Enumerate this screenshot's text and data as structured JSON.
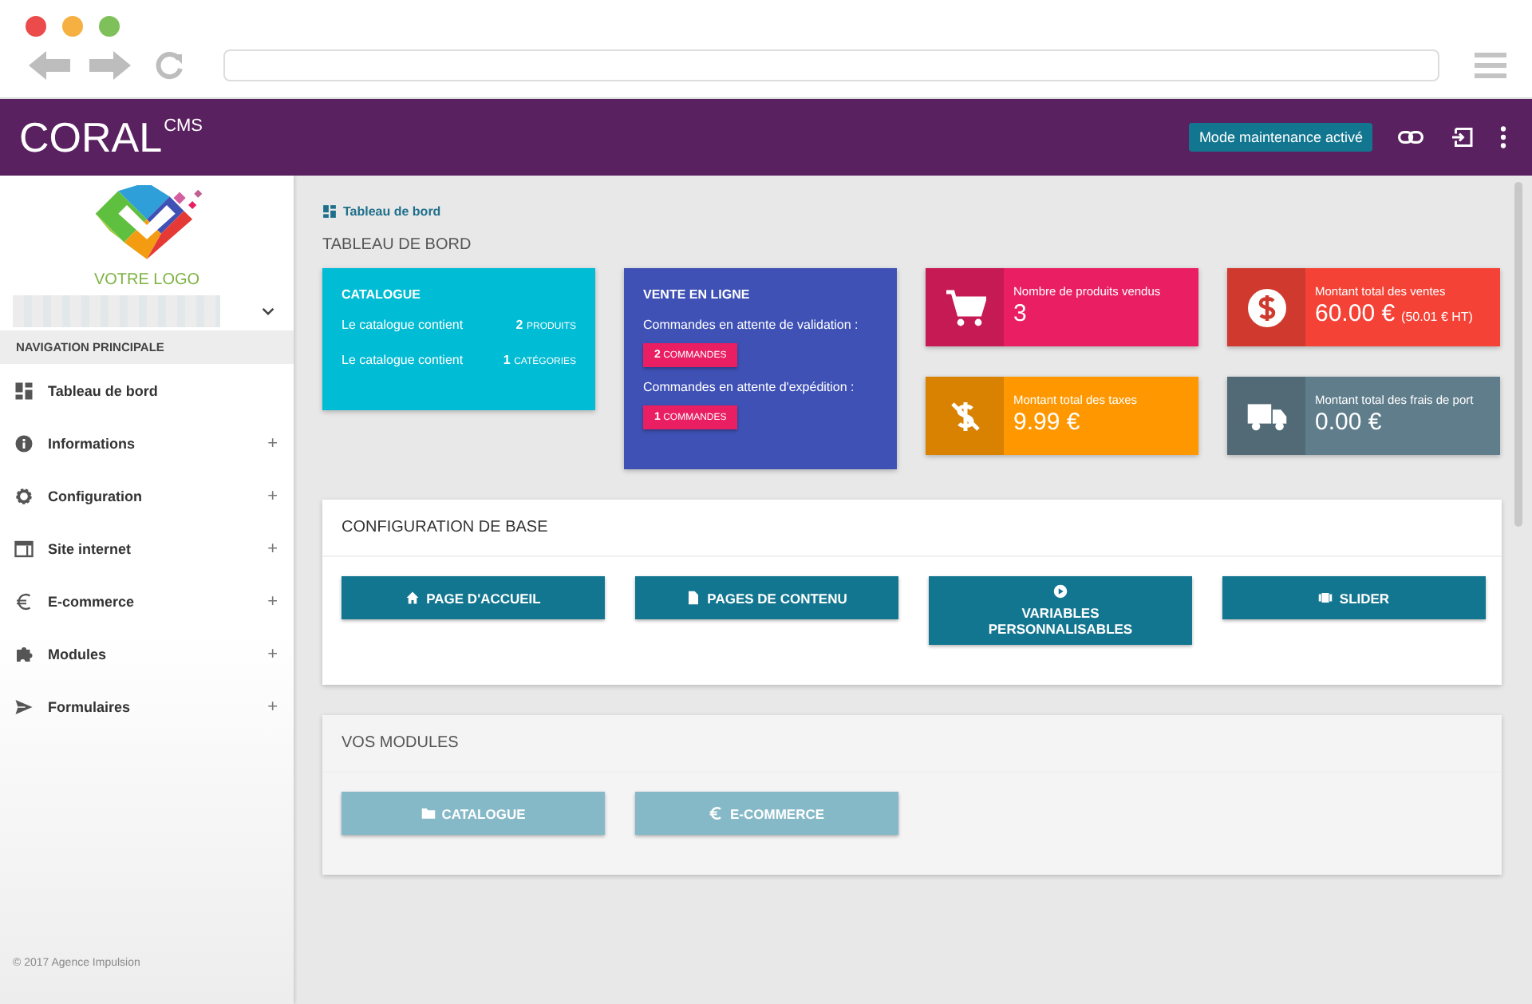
{
  "header": {
    "logo": "CORAL",
    "logo_suffix": "CMS",
    "maintenance_button": "Mode maintenance activé"
  },
  "sidebar": {
    "logo_caption": "VOTRE LOGO",
    "nav_heading": "NAVIGATION PRINCIPALE",
    "items": [
      {
        "kind": "dashboard",
        "label": "Tableau de bord"
      },
      {
        "kind": "info",
        "label": "Informations",
        "expander": "+"
      },
      {
        "kind": "gear",
        "label": "Configuration",
        "expander": "+"
      },
      {
        "kind": "window",
        "label": "Site internet",
        "expander": "+"
      },
      {
        "kind": "euro",
        "label": "E-commerce",
        "expander": "+"
      },
      {
        "kind": "puzzle",
        "label": "Modules",
        "expander": "+"
      },
      {
        "kind": "send",
        "label": "Formulaires",
        "expander": "+"
      }
    ],
    "footer": "© 2017 Agence Impulsion"
  },
  "breadcrumb": "Tableau de bord",
  "page_title": "TABLEAU DE BORD",
  "catalogue_card": {
    "title": "CATALOGUE",
    "rows": [
      {
        "label": "Le catalogue contient",
        "count": "2",
        "unit": "PRODUITS"
      },
      {
        "label": "Le catalogue contient",
        "count": "1",
        "unit": "CATÉGORIES"
      }
    ]
  },
  "sales_card": {
    "title": "VENTE EN LIGNE",
    "rows": [
      {
        "label": "Commandes en attente de validation :",
        "count": "2",
        "unit": "COMMANDES"
      },
      {
        "label": "Commandes en attente d'expédition :",
        "count": "1",
        "unit": "COMMANDES"
      }
    ]
  },
  "stats": [
    {
      "kind": "cart",
      "label": "Nombre de produits vendus",
      "value": "3",
      "color": "#e91e63"
    },
    {
      "kind": "dollar",
      "label": "Montant total des ventes",
      "value": "60.00 €",
      "extra": "(50.01 € HT)",
      "color": "#f44336"
    },
    {
      "kind": "tax",
      "label": "Montant total des taxes",
      "value": "9.99 €",
      "color": "#ff9800"
    },
    {
      "kind": "truck",
      "label": "Montant total des frais de port",
      "value": "0.00 €",
      "color": "#607d8b"
    }
  ],
  "sections": [
    {
      "title": "CONFIGURATION DE BASE",
      "dimmed": false,
      "buttons": [
        {
          "kind": "home",
          "label": "PAGE D'ACCUEIL"
        },
        {
          "kind": "file",
          "label": "PAGES DE CONTENU"
        },
        {
          "kind": "disc",
          "label": "VARIABLES PERSONNALISABLES"
        },
        {
          "kind": "slider",
          "label": "SLIDER"
        }
      ]
    },
    {
      "title": "VOS MODULES",
      "dimmed": true,
      "buttons": [
        {
          "kind": "folder",
          "label": "CATALOGUE"
        },
        {
          "kind": "euro",
          "label": "E-COMMERCE"
        }
      ]
    }
  ]
}
